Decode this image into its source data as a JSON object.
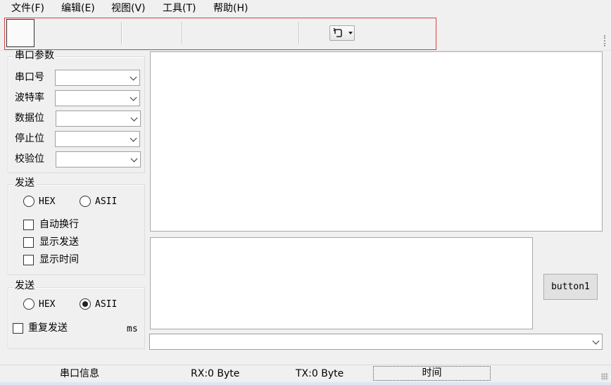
{
  "menu": [
    "文件(F)",
    "编辑(E)",
    "视图(V)",
    "工具(T)",
    "帮助(H)"
  ],
  "toolbar": {
    "refresh_icon": "refresh-icon"
  },
  "serial_group": {
    "title": "串口参数",
    "fields": [
      {
        "label": "串口号",
        "value": ""
      },
      {
        "label": "波特率",
        "value": ""
      },
      {
        "label": "数据位",
        "value": ""
      },
      {
        "label": "停止位",
        "value": ""
      },
      {
        "label": "校验位",
        "value": ""
      }
    ]
  },
  "send_group": {
    "title": "发送",
    "radio_hex": "HEX",
    "radio_ascii": "ASII",
    "selected": "none",
    "checks": [
      {
        "label": "自动换行",
        "checked": false
      },
      {
        "label": "显示发送",
        "checked": false
      },
      {
        "label": "显示时间",
        "checked": false
      }
    ]
  },
  "send_group2": {
    "title": "发送",
    "radio_hex": "HEX",
    "radio_ascii": "ASII",
    "selected": "ASII",
    "repeat_label": "重复发送",
    "repeat_checked": false,
    "unit": "ms"
  },
  "receive_text": "",
  "send_text": "",
  "button1_label": "button1",
  "command_combo_value": "",
  "status": {
    "port_info": "串口信息",
    "rx": "RX:0 Byte",
    "tx": "TX:0 Byte",
    "time": "时间"
  }
}
